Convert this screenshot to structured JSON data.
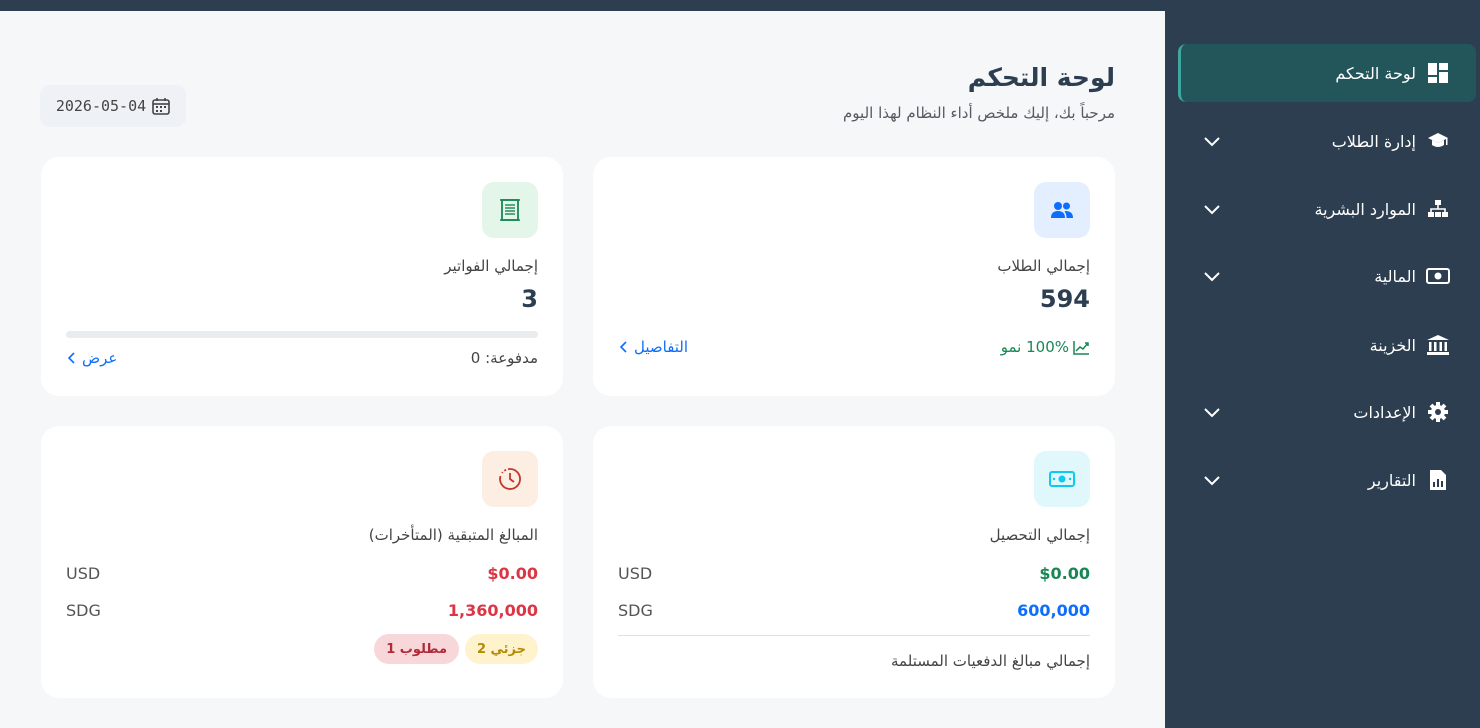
{
  "sidebar": {
    "items": [
      {
        "label": "لوحة التحكم",
        "icon": "dashboard-icon",
        "active": true
      },
      {
        "label": "إدارة الطلاب",
        "icon": "graduation-cap-icon",
        "has_children": true
      },
      {
        "label": "الموارد البشرية",
        "icon": "sitemap-icon",
        "has_children": true
      },
      {
        "label": "المالية",
        "icon": "money-bill-icon",
        "has_children": true
      },
      {
        "label": "الخزينة",
        "icon": "bank-icon",
        "has_children": false
      },
      {
        "label": "الإعدادات",
        "icon": "gear-icon",
        "has_children": true
      },
      {
        "label": "التقارير",
        "icon": "report-file-icon",
        "has_children": true
      }
    ]
  },
  "header": {
    "title": "لوحة التحكم",
    "subtitle": "مرحباً بك، إليك ملخص أداء النظام لهذا اليوم",
    "date": "2026-05-04"
  },
  "cards": {
    "students": {
      "label": "إجمالي الطلاب",
      "value": "594",
      "growth": "100% نمو",
      "details_link": "التفاصيل"
    },
    "invoices": {
      "label": "إجمالي الفواتير",
      "value": "3",
      "paid": "مدفوعة: 0",
      "paid_fraction": 0,
      "view_link": "عرض"
    },
    "collection": {
      "label": "إجمالي التحصيل",
      "usd_value": "$0.00",
      "usd_label": "USD",
      "sdg_value": "600,000",
      "sdg_label": "SDG",
      "footer": "إجمالي مبالغ الدفعيات المستلمة"
    },
    "outstanding": {
      "label": "المبالغ المتبقية (المتأخرات)",
      "usd_value": "$0.00",
      "usd_label": "USD",
      "sdg_value": "1,360,000",
      "sdg_label": "SDG",
      "badge_partial": "جزئي 2",
      "badge_required": "مطلوب 1"
    }
  },
  "colors": {
    "sidebar_bg": "#2c3e50",
    "active_bg": "#23565b",
    "green": "#198754",
    "blue": "#0d6efd",
    "red": "#dc3545"
  }
}
